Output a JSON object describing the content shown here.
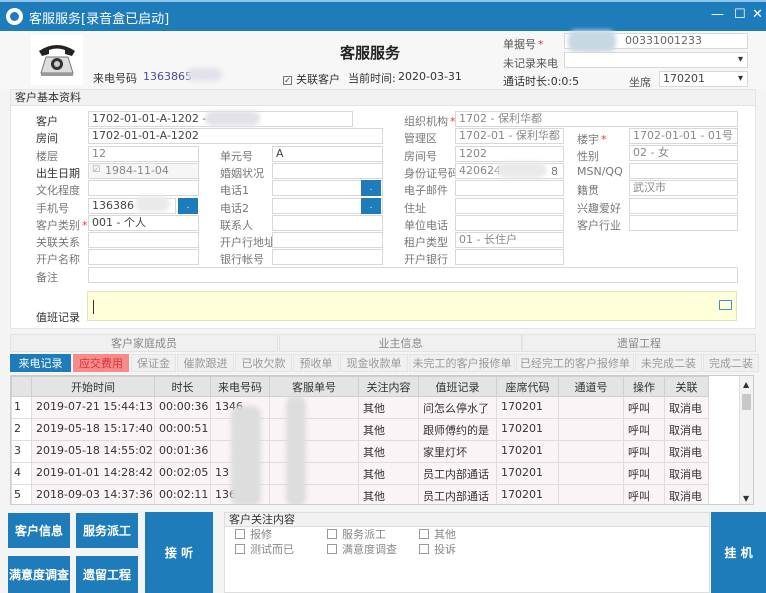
{
  "window": {
    "title": "客服服务[录音盒已启动]",
    "controls": [
      "—",
      "☐",
      "✕"
    ]
  },
  "header": {
    "heading": "客服服务",
    "caller_label": "来电号码",
    "caller_value": "1363865",
    "link_customer_label": "关联客户",
    "link_customer_checked": true,
    "current_time_label": "当前时间:",
    "current_time_value": "2020-03-31",
    "doc_no_label": "单据号",
    "doc_no_value": "00331001233",
    "unrecorded_call_label": "未记录来电",
    "unrecorded_call_value": "",
    "call_duration": "通话时长:0:0:5",
    "seat_label": "坐席",
    "seat_value": "170201"
  },
  "customer": {
    "section_title": "客户基本资料",
    "fields": {
      "customer": {
        "label": "客户",
        "value": "1702-01-01-A-1202 -"
      },
      "room": {
        "label": "房间",
        "value": "1702-01-01-A-1202"
      },
      "floor": {
        "label": "楼层",
        "value": "12"
      },
      "unit_no": {
        "label": "单元号",
        "value": "A"
      },
      "birth_date": {
        "label": "出生日期",
        "value": "1984-11-04"
      },
      "marital": {
        "label": "婚姻状况",
        "value": ""
      },
      "education": {
        "label": "文化程度",
        "value": ""
      },
      "phone1": {
        "label": "电话1",
        "value": ""
      },
      "mobile": {
        "label": "手机号",
        "value": "136386"
      },
      "phone2": {
        "label": "电话2",
        "value": ""
      },
      "cust_type": {
        "label": "客户类别",
        "value": "001 - 个人"
      },
      "contact": {
        "label": "联系人",
        "value": ""
      },
      "relation": {
        "label": "关联关系",
        "value": ""
      },
      "bank_address": {
        "label": "开户行地址",
        "value": ""
      },
      "account_name": {
        "label": "开户名称",
        "value": ""
      },
      "bank_account": {
        "label": "银行帐号",
        "value": ""
      },
      "remark": {
        "label": "备注",
        "value": ""
      },
      "org": {
        "label": "组织机构",
        "value": "1702 - 保利华都"
      },
      "mgmt_area": {
        "label": "管理区",
        "value": "1702-01 - 保利华都"
      },
      "building": {
        "label": "楼宇",
        "value": "1702-01-01 - 01号"
      },
      "room_no": {
        "label": "房间号",
        "value": "1202"
      },
      "gender": {
        "label": "性别",
        "value": "02 - 女"
      },
      "id_no": {
        "label": "身份证号码",
        "value": "420624",
        "value_tail": "8"
      },
      "msn": {
        "label": "MSN/QQ",
        "value": ""
      },
      "email": {
        "label": "电子邮件",
        "value": ""
      },
      "native": {
        "label": "籍贯",
        "value": "武汉市"
      },
      "address": {
        "label": "住址",
        "value": ""
      },
      "hobby": {
        "label": "兴趣爱好",
        "value": ""
      },
      "work_phone": {
        "label": "单位电话",
        "value": ""
      },
      "industry": {
        "label": "客户行业",
        "value": ""
      },
      "tenant_type": {
        "label": "租户类型",
        "value": "01 - 长住户"
      },
      "bank": {
        "label": "开户银行",
        "value": ""
      }
    },
    "duty_log_label": "值班记录",
    "duty_log_value": ""
  },
  "tabs_top": [
    "客户家庭成员",
    "业主信息",
    "遗留工程"
  ],
  "tabs_bottom": [
    "来电记录",
    "应交费用",
    "保证金",
    "催款跟进",
    "已收欠款",
    "预收单",
    "现金收款单",
    "未完工的客户报修单",
    "已经完工的客户报修单",
    "未完成二装",
    "完成二装"
  ],
  "call_table": {
    "columns": [
      "",
      "开始时间",
      "时长",
      "来电号码",
      "客服单号",
      "关注内容",
      "值班记录",
      "座席代码",
      "通道号",
      "操作",
      "关联"
    ],
    "rows": [
      [
        "1",
        "2019-07-21 15:44:13",
        "00:00:36",
        "1346",
        "",
        "其他",
        "问怎么停水了",
        "170201",
        "",
        "呼叫",
        "取消电"
      ],
      [
        "2",
        "2019-05-18 15:17:40",
        "00:00:51",
        "",
        "",
        "其他",
        "跟师傅约的是",
        "170201",
        "",
        "呼叫",
        "取消电"
      ],
      [
        "3",
        "2019-05-18 14:55:02",
        "00:01:36",
        "",
        "",
        "其他",
        "家里灯坏",
        "170201",
        "",
        "呼叫",
        "取消电"
      ],
      [
        "4",
        "2019-01-01 14:28:42",
        "00:02:05",
        "13",
        "",
        "其他",
        "员工内部通话",
        "170201",
        "",
        "呼叫",
        "取消电"
      ],
      [
        "5",
        "2018-09-03 14:37:36",
        "00:02:11",
        "136",
        "",
        "其他",
        "员工内部通话",
        "170201",
        "",
        "呼叫",
        "取消电"
      ]
    ]
  },
  "buttons": {
    "customer_info": "客户信息",
    "service_dispatch": "服务派工",
    "satisfaction": "满意度调查",
    "legacy_project": "遗留工程",
    "answer": "接 听",
    "hangup": "挂 机"
  },
  "focus": {
    "title": "客户关注内容",
    "options": [
      {
        "label": "报修",
        "checked": false
      },
      {
        "label": "服务派工",
        "checked": false
      },
      {
        "label": "其他",
        "checked": false
      },
      {
        "label": "测试而已",
        "checked": false
      },
      {
        "label": "满意度调查",
        "checked": false
      },
      {
        "label": "投诉",
        "checked": false
      }
    ]
  },
  "colors": {
    "accent": "#1e7cbb",
    "tab_red": "#f58b8b",
    "note_bg": "#fefed8"
  }
}
